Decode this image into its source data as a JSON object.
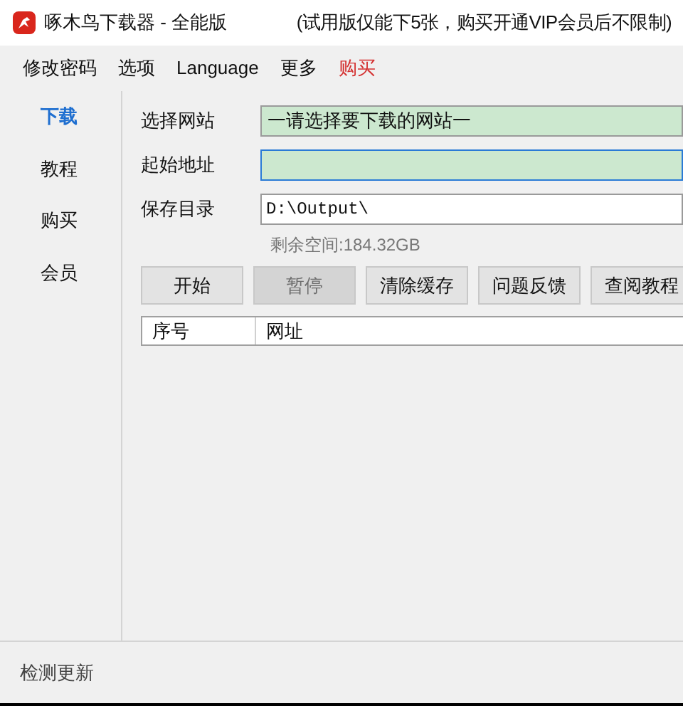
{
  "window": {
    "title": "啄木鸟下载器 - 全能版",
    "notice": "(试用版仅能下5张，购买开通VIP会员后不限制)"
  },
  "menu": [
    {
      "label": "修改密码",
      "kind": "normal"
    },
    {
      "label": "选项",
      "kind": "normal"
    },
    {
      "label": "Language",
      "kind": "normal"
    },
    {
      "label": "更多",
      "kind": "normal"
    },
    {
      "label": "购买",
      "kind": "highlight"
    }
  ],
  "sidebar": {
    "items": [
      {
        "label": "下载",
        "selected": true
      },
      {
        "label": "教程",
        "selected": false
      },
      {
        "label": "购买",
        "selected": false
      },
      {
        "label": "会员",
        "selected": false
      }
    ]
  },
  "form": {
    "site": {
      "label": "选择网站",
      "value": "一请选择要下载的网站一"
    },
    "start_url": {
      "label": "起始地址"
    },
    "save_dir": {
      "label": "保存目录",
      "value": "D:\\Output\\"
    },
    "free_space": "剩余空间:184.32GB"
  },
  "buttons": [
    {
      "label": "开始",
      "disabled": false
    },
    {
      "label": "暂停",
      "disabled": true
    },
    {
      "label": "清除缓存",
      "disabled": false
    },
    {
      "label": "问题反馈",
      "disabled": false
    },
    {
      "label": "查阅教程",
      "disabled": false
    }
  ],
  "table": {
    "columns": [
      "序号",
      "网址"
    ]
  },
  "footer": {
    "link": "检测更新"
  }
}
